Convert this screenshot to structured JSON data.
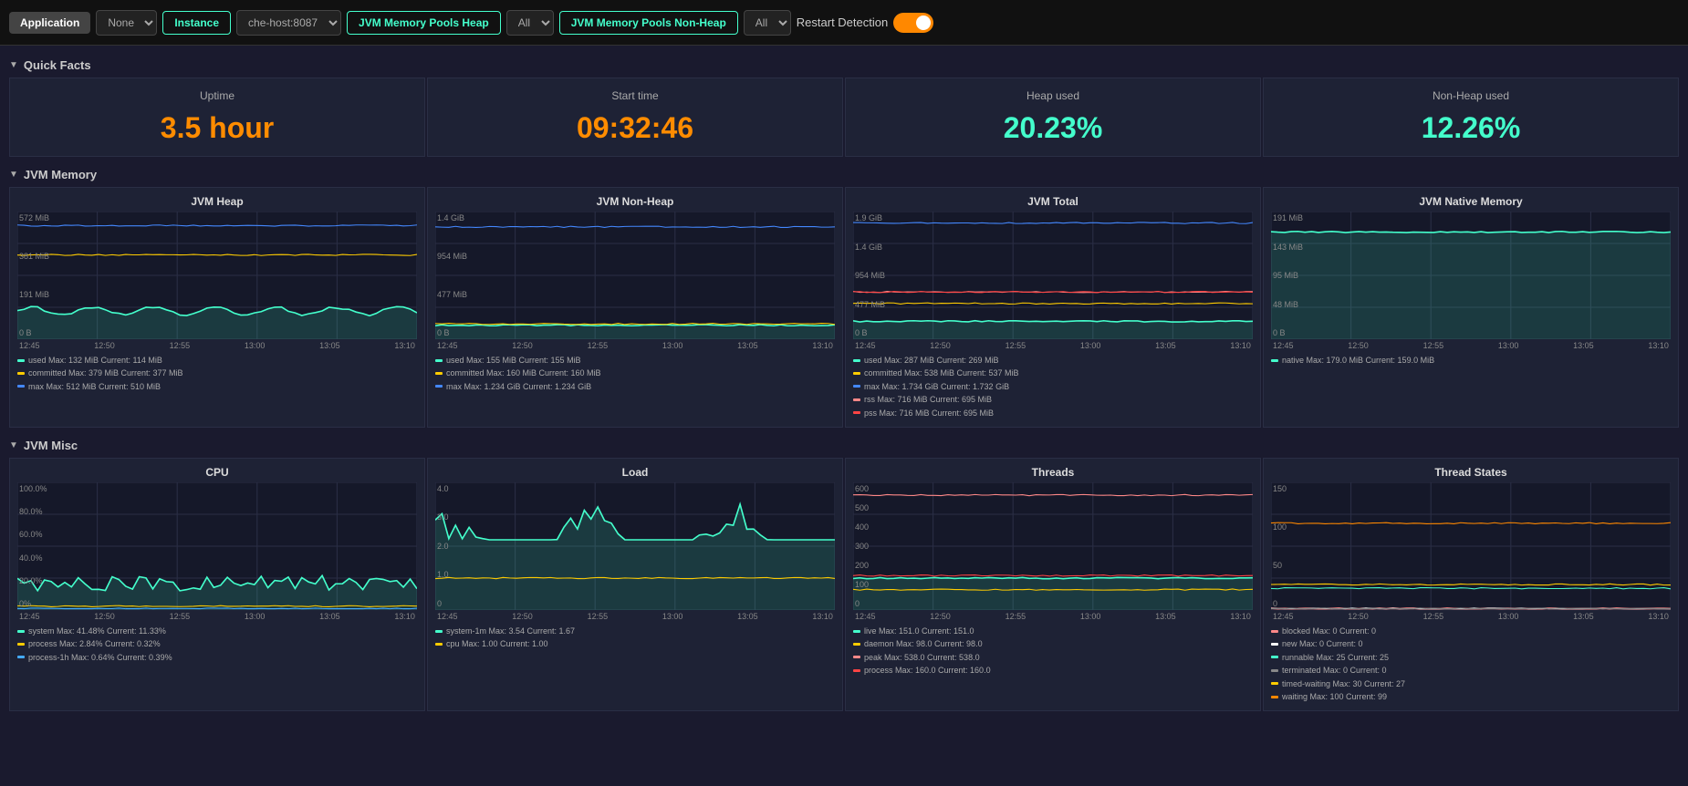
{
  "nav": {
    "application_label": "Application",
    "none_label": "None",
    "instance_label": "Instance",
    "host_label": "che-host:8087",
    "jvm_heap_label": "JVM Memory Pools Heap",
    "all1_label": "All",
    "jvm_nonheap_label": "JVM Memory Pools Non-Heap",
    "all2_label": "All",
    "restart_label": "Restart Detection"
  },
  "quick_facts": {
    "title": "Quick Facts",
    "items": [
      {
        "label": "Uptime",
        "value": "3.5 hour",
        "color": "orange"
      },
      {
        "label": "Start time",
        "value": "09:32:46",
        "color": "orange"
      },
      {
        "label": "Heap used",
        "value": "20.23%",
        "color": "green"
      },
      {
        "label": "Non-Heap used",
        "value": "12.26%",
        "color": "green"
      }
    ]
  },
  "jvm_memory": {
    "title": "JVM Memory",
    "charts": [
      {
        "title": "JVM Heap",
        "y_labels": [
          "572 MiB",
          "381 MiB",
          "191 MiB",
          "0 B"
        ],
        "x_labels": [
          "12:45",
          "12:50",
          "12:55",
          "13:00",
          "13:05",
          "13:10"
        ],
        "legend": [
          {
            "color": "#4fc",
            "text": "used  Max: 132 MiB  Current: 114 MiB"
          },
          {
            "color": "#fc0",
            "text": "committed  Max: 379 MiB  Current: 377 MiB"
          },
          {
            "color": "#48f",
            "text": "max  Max: 512 MiB  Current: 510 MiB"
          }
        ]
      },
      {
        "title": "JVM Non-Heap",
        "y_labels": [
          "1.4 GiB",
          "954 MiB",
          "477 MiB",
          "0 B"
        ],
        "x_labels": [
          "12:45",
          "12:50",
          "12:55",
          "13:00",
          "13:05",
          "13:10"
        ],
        "legend": [
          {
            "color": "#4fc",
            "text": "used  Max: 155 MiB  Current: 155 MiB"
          },
          {
            "color": "#fc0",
            "text": "committed  Max: 160 MiB  Current: 160 MiB"
          },
          {
            "color": "#48f",
            "text": "max  Max: 1.234 GiB  Current: 1.234 GiB"
          }
        ]
      },
      {
        "title": "JVM Total",
        "y_labels": [
          "1.9 GiB",
          "1.4 GiB",
          "954 MiB",
          "477 MiB",
          "0 B"
        ],
        "x_labels": [
          "12:45",
          "12:50",
          "12:55",
          "13:00",
          "13:05",
          "13:10"
        ],
        "legend": [
          {
            "color": "#4fc",
            "text": "used  Max: 287 MiB  Current: 269 MiB"
          },
          {
            "color": "#fc0",
            "text": "committed  Max: 538 MiB  Current: 537 MiB"
          },
          {
            "color": "#48f",
            "text": "max  Max: 1.734 GiB  Current: 1.732 GiB"
          },
          {
            "color": "#f88",
            "text": "rss  Max: 716 MiB  Current: 695 MiB"
          },
          {
            "color": "#f44",
            "text": "pss  Max: 716 MiB  Current: 695 MiB"
          }
        ]
      },
      {
        "title": "JVM Native Memory",
        "y_labels": [
          "191 MiB",
          "143 MiB",
          "95 MiB",
          "48 MiB",
          "0 B"
        ],
        "x_labels": [
          "12:45",
          "12:50",
          "12:55",
          "13:00",
          "13:05",
          "13:10"
        ],
        "legend": [
          {
            "color": "#4fc",
            "text": "native  Max: 179.0 MiB  Current: 159.0 MiB"
          }
        ]
      }
    ]
  },
  "jvm_misc": {
    "title": "JVM Misc",
    "charts": [
      {
        "title": "CPU",
        "y_labels": [
          "100.0%",
          "80.0%",
          "60.0%",
          "40.0%",
          "20.0%",
          "0%"
        ],
        "x_labels": [
          "12:45",
          "12:50",
          "12:55",
          "13:00",
          "13:05",
          "13:10"
        ],
        "legend": [
          {
            "color": "#4fc",
            "text": "system  Max: 41.48%  Current: 11.33%"
          },
          {
            "color": "#fc0",
            "text": "process  Max: 2.84%  Current: 0.32%"
          },
          {
            "color": "#4af",
            "text": "process-1h  Max: 0.64%  Current: 0.39%"
          }
        ]
      },
      {
        "title": "Load",
        "y_labels": [
          "4.0",
          "3.0",
          "2.0",
          "1.0",
          "0"
        ],
        "x_labels": [
          "12:45",
          "12:50",
          "12:55",
          "13:00",
          "13:05",
          "13:10"
        ],
        "legend": [
          {
            "color": "#4fc",
            "text": "system-1m  Max: 3.54  Current: 1.67"
          },
          {
            "color": "#fc0",
            "text": "cpu  Max: 1.00  Current: 1.00"
          }
        ]
      },
      {
        "title": "Threads",
        "y_labels": [
          "600",
          "500",
          "400",
          "300",
          "200",
          "100",
          "0"
        ],
        "x_labels": [
          "12:45",
          "12:50",
          "12:55",
          "13:00",
          "13:05",
          "13:10"
        ],
        "legend": [
          {
            "color": "#4fc",
            "text": "live  Max: 151.0  Current: 151.0"
          },
          {
            "color": "#fc0",
            "text": "daemon  Max: 98.0  Current: 98.0"
          },
          {
            "color": "#f88",
            "text": "peak  Max: 538.0  Current: 538.0"
          },
          {
            "color": "#f44",
            "text": "process  Max: 160.0  Current: 160.0"
          }
        ]
      },
      {
        "title": "Thread States",
        "y_labels": [
          "150",
          "100",
          "50",
          "0"
        ],
        "x_labels": [
          "12:45",
          "12:50",
          "12:55",
          "13:00",
          "13:05",
          "13:10"
        ],
        "legend": [
          {
            "color": "#f88",
            "text": "blocked  Max: 0  Current: 0"
          },
          {
            "color": "#fff",
            "text": "new  Max: 0  Current: 0"
          },
          {
            "color": "#4fc",
            "text": "runnable  Max: 25  Current: 25"
          },
          {
            "color": "#888",
            "text": "terminated  Max: 0  Current: 0"
          },
          {
            "color": "#fc0",
            "text": "timed-waiting  Max: 30  Current: 27"
          },
          {
            "color": "#f80",
            "text": "waiting  Max: 100  Current: 99"
          }
        ]
      }
    ]
  }
}
